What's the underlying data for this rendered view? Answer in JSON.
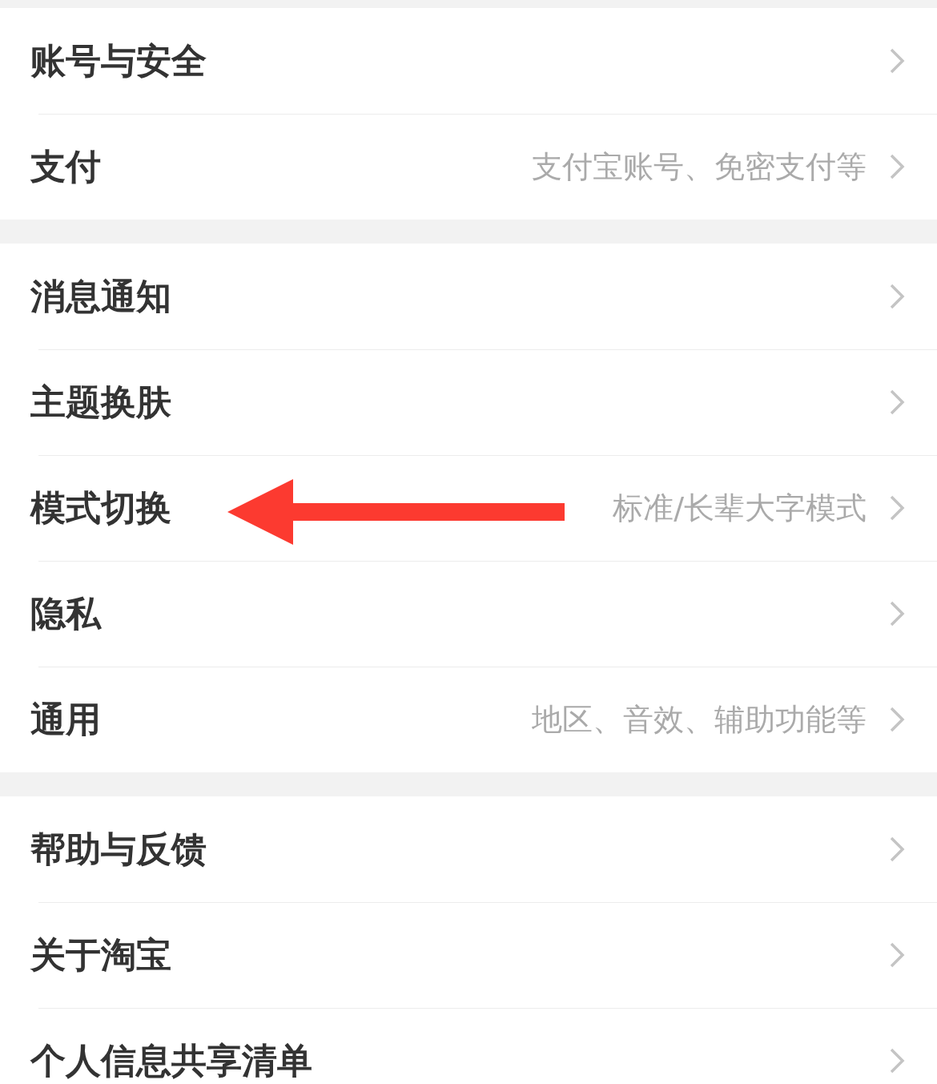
{
  "sections": [
    {
      "rows": [
        {
          "label": "账号与安全"
        },
        {
          "label": "支付",
          "value": "支付宝账号、免密支付等"
        }
      ]
    },
    {
      "rows": [
        {
          "label": "消息通知"
        },
        {
          "label": "主题换肤"
        },
        {
          "label": "模式切换",
          "value": "标准/长辈大字模式"
        },
        {
          "label": "隐私"
        },
        {
          "label": "通用",
          "value": "地区、音效、辅助功能等"
        }
      ]
    },
    {
      "rows": [
        {
          "label": "帮助与反馈"
        },
        {
          "label": "关于淘宝"
        },
        {
          "label": "个人信息共享清单"
        }
      ]
    }
  ],
  "annotations": [
    {
      "kind": "arrow"
    }
  ]
}
